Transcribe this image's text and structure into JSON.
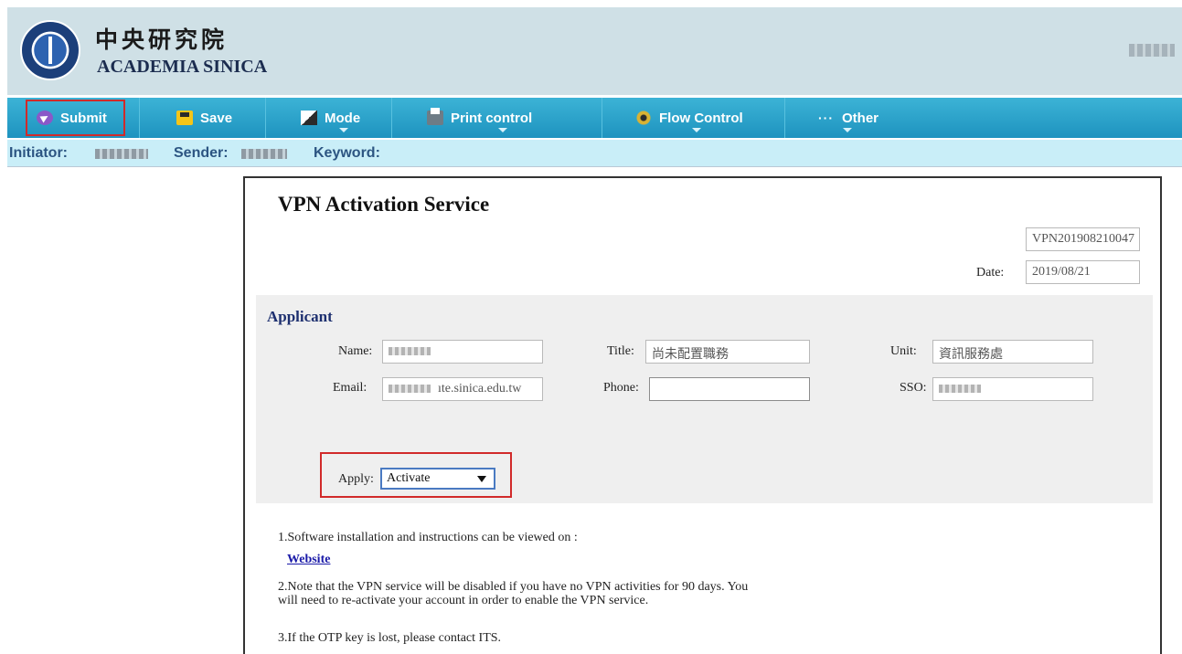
{
  "header": {
    "logo_zh": "中央研究院",
    "logo_en": "ACADEMIA SINICA"
  },
  "toolbar": {
    "submit": "Submit",
    "save": "Save",
    "mode": "Mode",
    "print_control": "Print control",
    "flow_control": "Flow Control",
    "other": "Other"
  },
  "infobar": {
    "initiator_label": "Initiator:",
    "sender_label": "Sender:",
    "keyword_label": "Keyword:"
  },
  "form": {
    "title": "VPN Activation Service",
    "form_number": "VPN201908210047",
    "date_label": "Date:",
    "date_value": "2019/08/21",
    "applicant": {
      "section_title": "Applicant",
      "name_label": "Name:",
      "title_label": "Title:",
      "title_value": "尚未配置職務",
      "unit_label": "Unit:",
      "unit_value": "資訊服務處",
      "email_label": "Email:",
      "email_value": "ıte.sinica.edu.tw",
      "phone_label": "Phone:",
      "phone_value": "",
      "sso_label": "SSO:"
    },
    "apply_label": "Apply:",
    "apply_value": "Activate",
    "notes": {
      "note1": "1.Software installation and instructions can be viewed on :",
      "website_link": "Website",
      "note2_line1": "2.Note that the VPN service will be disabled if you have no VPN activities for 90 days. You",
      "note2_line2": "will need to re-activate your account in order to enable the VPN service.",
      "note3": "3.If the OTP key is lost, please contact ITS."
    }
  },
  "colors": {
    "toolbar": "#1e93bf",
    "header_bg": "#cfe0e6",
    "infobar_bg": "#c9eef8",
    "highlight": "#d12a2a"
  }
}
